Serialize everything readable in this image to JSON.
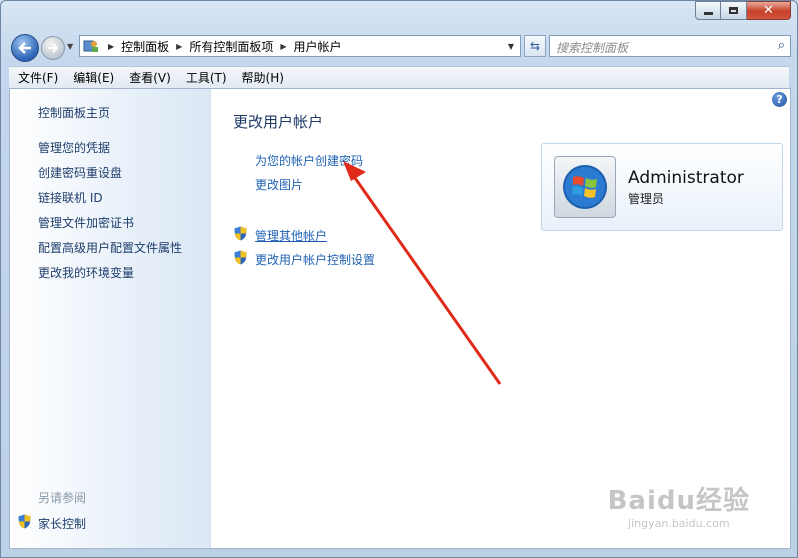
{
  "nav": {
    "breadcrumbs": [
      "控制面板",
      "所有控制面板项",
      "用户帐户"
    ],
    "search_placeholder": "搜索控制面板"
  },
  "menu": [
    "文件(F)",
    "编辑(E)",
    "查看(V)",
    "工具(T)",
    "帮助(H)"
  ],
  "sidebar": {
    "items": [
      "控制面板主页",
      "管理您的凭据",
      "创建密码重设盘",
      "链接联机 ID",
      "管理文件加密证书",
      "配置高级用户配置文件属性",
      "更改我的环境变量"
    ],
    "see_also_label": "另请参阅",
    "see_also_items": [
      "家长控制"
    ]
  },
  "main": {
    "title": "更改用户帐户",
    "tasks": [
      "为您的帐户创建密码",
      "更改图片"
    ],
    "shield_tasks": [
      "管理其他帐户",
      "更改用户帐户控制设置"
    ]
  },
  "account": {
    "name": "Administrator",
    "role": "管理员"
  },
  "watermark": {
    "brand": "Baidu经验",
    "url": "jingyan.baidu.com"
  },
  "colors": {
    "link": "#1f62b4",
    "annotation_arrow": "#e02a1a"
  }
}
